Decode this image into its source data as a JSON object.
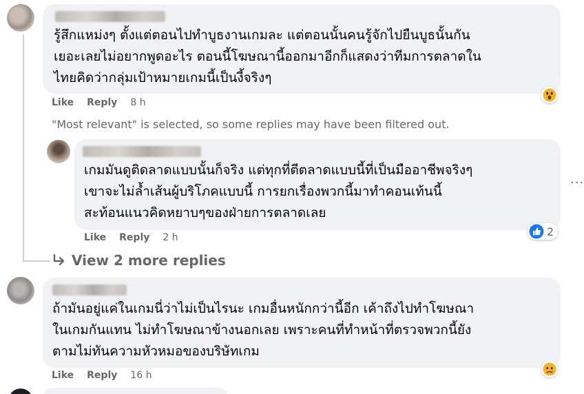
{
  "comments": [
    {
      "text_lines": [
        "รู้สึกแหม่งๆ ตั้งแต่ตอนไปทำบูธงานเกมละ แต่ตอนนั้นคนรู้จักไปยืนบูธนั้นกัน",
        "เยอะเลยไม่อยากพูดอะไร ตอนนี้โฆษณานี้ออกมาอีกก็แสดงว่าทีมการตลาดใน",
        "ไทยคิดว่ากลุ่มเป้าหมายเกมนี้เป็นงี้จริงๆ"
      ],
      "like_label": "Like",
      "reply_label": "Reply",
      "time": "8 h",
      "reaction": "wow"
    },
    {
      "text_lines": [
        "เกมมันดูติดลาดแบบนั้นก็จริง แต่ทุกที่ตีตลาดแบบนี้ที่เป็นมืออาชีพจริงๆ",
        "เขาจะไม่ล้ำเส้นผู้บริโภคแบบนี้ การยกเรื่องพวกนี้มาทำคอนเท้นนี้",
        "สะท้อนแนวคิดหยาบๆของฝ่ายการตลาดเลย"
      ],
      "like_label": "Like",
      "reply_label": "Reply",
      "time": "2 h",
      "reaction": "like",
      "reaction_count": "2"
    },
    {
      "text_lines": [
        "ถ้ามันอยู่แค่ในเกมนี่ว่าไม่เป็นไรนะ เกมอื่นหนักกว่านี้อีก เค้าถึงไปทำโฆษณา",
        "ในเกมกันแทน ไม่ทำโฆษณาข้างนอกเลย เพราะคนที่ทำหน้าที่ตรวจพวกนี้ยัง",
        "ตามไม่ทันความหัวหมอของบริษัทเกม"
      ],
      "like_label": "Like",
      "reply_label": "Reply",
      "time": "16 h",
      "reaction": "sad"
    }
  ],
  "filter_note": "\"Most relevant\" is selected, so some replies may have been filtered out.",
  "more_replies": "View 2 more replies",
  "more_options": "···",
  "colors": {
    "bubble": "#f0f2f5",
    "secondary_text": "#65676b",
    "like_blue": "#1877f2"
  }
}
